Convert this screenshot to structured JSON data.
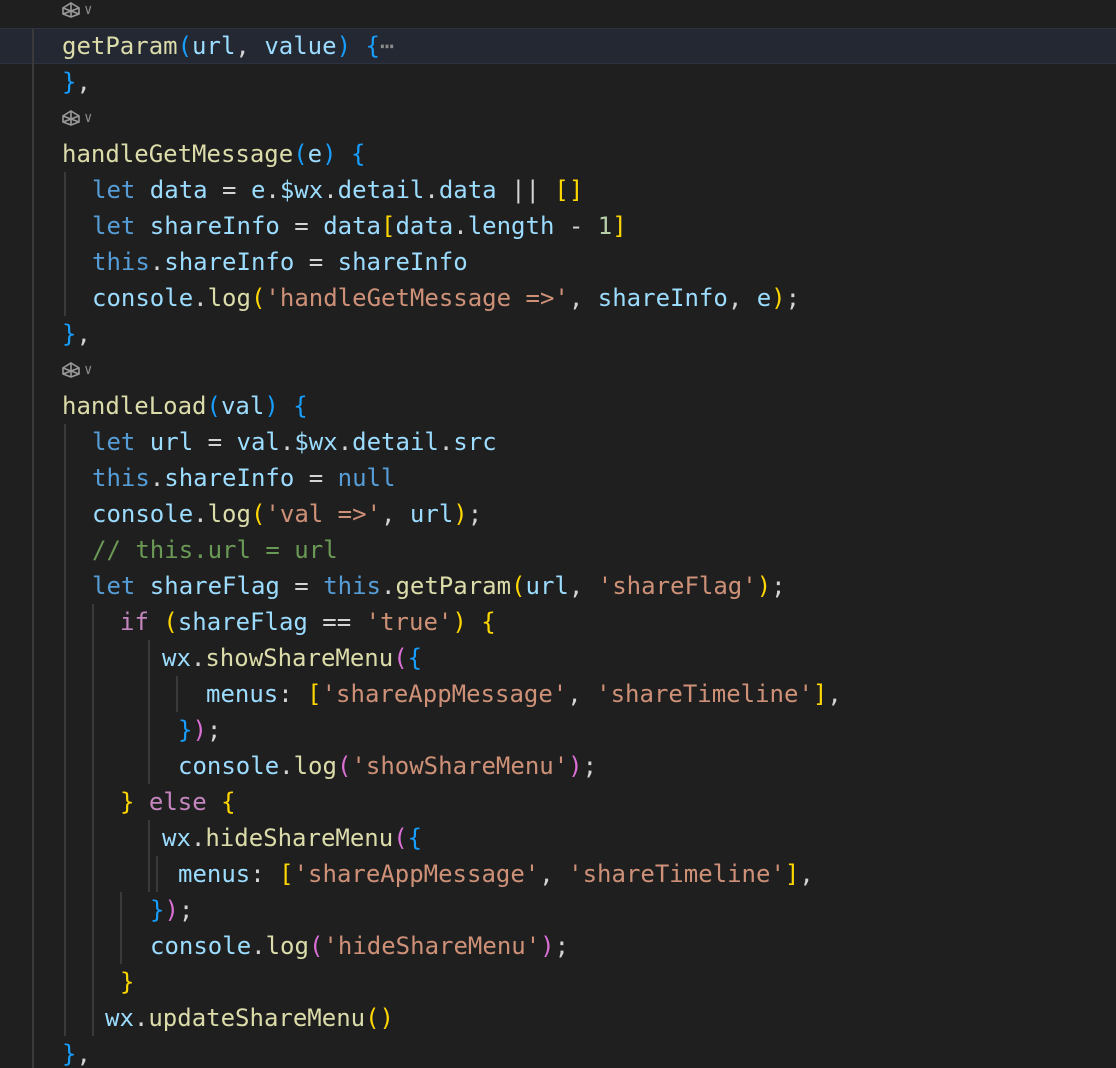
{
  "editor": {
    "lines": [
      {
        "id": "top-partial",
        "tokens": [],
        "guides": [],
        "lens": true
      },
      {
        "id": "getparam",
        "current": true,
        "tokens": [
          {
            "t": "getParam",
            "c": "fn"
          },
          {
            "t": "(",
            "c": "b3"
          },
          {
            "t": "url",
            "c": "var"
          },
          {
            "t": ", ",
            "c": "op"
          },
          {
            "t": "value",
            "c": "var"
          },
          {
            "t": ") ",
            "c": "b3"
          },
          {
            "t": "{",
            "c": "b3"
          },
          {
            "t": "⋯",
            "c": "fold"
          }
        ]
      },
      {
        "id": "close-getparam",
        "tokens": [
          {
            "t": "}",
            "c": "b3"
          },
          {
            "t": ",",
            "c": "op"
          }
        ]
      },
      {
        "id": "lens-1",
        "lens": true
      },
      {
        "id": "handleGetMessage",
        "tokens": [
          {
            "t": "handleGetMessage",
            "c": "fn"
          },
          {
            "t": "(",
            "c": "b3"
          },
          {
            "t": "e",
            "c": "var"
          },
          {
            "t": ") ",
            "c": "b3"
          },
          {
            "t": "{",
            "c": "b3"
          }
        ]
      },
      {
        "id": "hgm-1",
        "indent": 1,
        "tokens": [
          {
            "t": "let ",
            "c": "kw"
          },
          {
            "t": "data",
            "c": "var"
          },
          {
            "t": " = ",
            "c": "op"
          },
          {
            "t": "e",
            "c": "var"
          },
          {
            "t": ".",
            "c": "op"
          },
          {
            "t": "$wx",
            "c": "var"
          },
          {
            "t": ".",
            "c": "op"
          },
          {
            "t": "detail",
            "c": "var"
          },
          {
            "t": ".",
            "c": "op"
          },
          {
            "t": "data",
            "c": "var"
          },
          {
            "t": " || ",
            "c": "op"
          },
          {
            "t": "[]",
            "c": "b1"
          }
        ]
      },
      {
        "id": "hgm-2",
        "indent": 1,
        "tokens": [
          {
            "t": "let ",
            "c": "kw"
          },
          {
            "t": "shareInfo",
            "c": "var"
          },
          {
            "t": " = ",
            "c": "op"
          },
          {
            "t": "data",
            "c": "var"
          },
          {
            "t": "[",
            "c": "b1"
          },
          {
            "t": "data",
            "c": "var"
          },
          {
            "t": ".",
            "c": "op"
          },
          {
            "t": "length",
            "c": "var"
          },
          {
            "t": " - ",
            "c": "op"
          },
          {
            "t": "1",
            "c": "num"
          },
          {
            "t": "]",
            "c": "b1"
          }
        ]
      },
      {
        "id": "hgm-3",
        "indent": 1,
        "tokens": [
          {
            "t": "this",
            "c": "kw"
          },
          {
            "t": ".",
            "c": "op"
          },
          {
            "t": "shareInfo",
            "c": "var"
          },
          {
            "t": " = ",
            "c": "op"
          },
          {
            "t": "shareInfo",
            "c": "var"
          }
        ]
      },
      {
        "id": "hgm-4",
        "indent": 1,
        "tokens": [
          {
            "t": "console",
            "c": "var"
          },
          {
            "t": ".",
            "c": "op"
          },
          {
            "t": "log",
            "c": "fn"
          },
          {
            "t": "(",
            "c": "b1"
          },
          {
            "t": "'handleGetMessage =>'",
            "c": "str"
          },
          {
            "t": ", ",
            "c": "op"
          },
          {
            "t": "shareInfo",
            "c": "var"
          },
          {
            "t": ", ",
            "c": "op"
          },
          {
            "t": "e",
            "c": "var"
          },
          {
            "t": ")",
            "c": "b1"
          },
          {
            "t": ";",
            "c": "op"
          }
        ]
      },
      {
        "id": "close-hgm",
        "tokens": [
          {
            "t": "}",
            "c": "b3"
          },
          {
            "t": ",",
            "c": "op"
          }
        ]
      },
      {
        "id": "lens-2",
        "lens": true
      },
      {
        "id": "handleLoad",
        "tokens": [
          {
            "t": "handleLoad",
            "c": "fn"
          },
          {
            "t": "(",
            "c": "b3"
          },
          {
            "t": "val",
            "c": "var"
          },
          {
            "t": ") ",
            "c": "b3"
          },
          {
            "t": "{",
            "c": "b3"
          }
        ]
      },
      {
        "id": "hl-1",
        "indent": 1,
        "tokens": [
          {
            "t": "let ",
            "c": "kw"
          },
          {
            "t": "url",
            "c": "var"
          },
          {
            "t": " = ",
            "c": "op"
          },
          {
            "t": "val",
            "c": "var"
          },
          {
            "t": ".",
            "c": "op"
          },
          {
            "t": "$wx",
            "c": "var"
          },
          {
            "t": ".",
            "c": "op"
          },
          {
            "t": "detail",
            "c": "var"
          },
          {
            "t": ".",
            "c": "op"
          },
          {
            "t": "src",
            "c": "var"
          }
        ]
      },
      {
        "id": "hl-2",
        "indent": 1,
        "tokens": [
          {
            "t": "this",
            "c": "kw"
          },
          {
            "t": ".",
            "c": "op"
          },
          {
            "t": "shareInfo",
            "c": "var"
          },
          {
            "t": " = ",
            "c": "op"
          },
          {
            "t": "null",
            "c": "kw"
          }
        ]
      },
      {
        "id": "hl-3",
        "indent": 1,
        "tokens": [
          {
            "t": "console",
            "c": "var"
          },
          {
            "t": ".",
            "c": "op"
          },
          {
            "t": "log",
            "c": "fn"
          },
          {
            "t": "(",
            "c": "b1"
          },
          {
            "t": "'val =>'",
            "c": "str"
          },
          {
            "t": ", ",
            "c": "op"
          },
          {
            "t": "url",
            "c": "var"
          },
          {
            "t": ")",
            "c": "b1"
          },
          {
            "t": ";",
            "c": "op"
          }
        ]
      },
      {
        "id": "hl-4",
        "indent": 1,
        "tokens": [
          {
            "t": "// this.url = url",
            "c": "cmt"
          }
        ]
      },
      {
        "id": "hl-5",
        "indent": 1,
        "tokens": [
          {
            "t": "let ",
            "c": "kw"
          },
          {
            "t": "shareFlag",
            "c": "var"
          },
          {
            "t": " = ",
            "c": "op"
          },
          {
            "t": "this",
            "c": "kw"
          },
          {
            "t": ".",
            "c": "op"
          },
          {
            "t": "getParam",
            "c": "fn"
          },
          {
            "t": "(",
            "c": "b1"
          },
          {
            "t": "url",
            "c": "var"
          },
          {
            "t": ", ",
            "c": "op"
          },
          {
            "t": "'shareFlag'",
            "c": "str"
          },
          {
            "t": ")",
            "c": "b1"
          },
          {
            "t": ";",
            "c": "op"
          }
        ]
      },
      {
        "id": "if",
        "indent": 2,
        "tokens": [
          {
            "t": "if ",
            "c": "ctl"
          },
          {
            "t": "(",
            "c": "b1"
          },
          {
            "t": "shareFlag",
            "c": "var"
          },
          {
            "t": " == ",
            "c": "op"
          },
          {
            "t": "'true'",
            "c": "str"
          },
          {
            "t": ") ",
            "c": "b1"
          },
          {
            "t": "{",
            "c": "b1"
          }
        ]
      },
      {
        "id": "show-1",
        "indent": 3,
        "tokens": [
          {
            "t": "wx",
            "c": "var"
          },
          {
            "t": ".",
            "c": "op"
          },
          {
            "t": "showShareMenu",
            "c": "fn"
          },
          {
            "t": "(",
            "c": "b2"
          },
          {
            "t": "{",
            "c": "b3"
          }
        ]
      },
      {
        "id": "show-2",
        "indent": 4,
        "tokens": [
          {
            "t": "menus",
            "c": "var"
          },
          {
            "t": ": ",
            "c": "op"
          },
          {
            "t": "[",
            "c": "b1"
          },
          {
            "t": "'shareAppMessage'",
            "c": "str"
          },
          {
            "t": ", ",
            "c": "op"
          },
          {
            "t": "'shareTimeline'",
            "c": "str"
          },
          {
            "t": "]",
            "c": "b1"
          },
          {
            "t": ",",
            "c": "op"
          }
        ]
      },
      {
        "id": "show-3",
        "indent": 5,
        "tokens": [
          {
            "t": "}",
            "c": "b3"
          },
          {
            "t": ")",
            "c": "b2"
          },
          {
            "t": ";",
            "c": "op"
          }
        ]
      },
      {
        "id": "show-4",
        "indent": 5,
        "tokens": [
          {
            "t": "console",
            "c": "var"
          },
          {
            "t": ".",
            "c": "op"
          },
          {
            "t": "log",
            "c": "fn"
          },
          {
            "t": "(",
            "c": "b2"
          },
          {
            "t": "'showShareMenu'",
            "c": "str"
          },
          {
            "t": ")",
            "c": "b2"
          },
          {
            "t": ";",
            "c": "op"
          }
        ]
      },
      {
        "id": "else",
        "indent": 2,
        "tokens": [
          {
            "t": "} ",
            "c": "b1"
          },
          {
            "t": "else ",
            "c": "ctl"
          },
          {
            "t": "{",
            "c": "b1"
          }
        ]
      },
      {
        "id": "hide-1",
        "indent": 3,
        "tokens": [
          {
            "t": "wx",
            "c": "var"
          },
          {
            "t": ".",
            "c": "op"
          },
          {
            "t": "hideShareMenu",
            "c": "fn"
          },
          {
            "t": "(",
            "c": "b2"
          },
          {
            "t": "{",
            "c": "b3"
          }
        ]
      },
      {
        "id": "hide-2",
        "indent": 6,
        "tokens": [
          {
            "t": "menus",
            "c": "var"
          },
          {
            "t": ": ",
            "c": "op"
          },
          {
            "t": "[",
            "c": "b1"
          },
          {
            "t": "'shareAppMessage'",
            "c": "str"
          },
          {
            "t": ", ",
            "c": "op"
          },
          {
            "t": "'shareTimeline'",
            "c": "str"
          },
          {
            "t": "]",
            "c": "b1"
          },
          {
            "t": ",",
            "c": "op"
          }
        ]
      },
      {
        "id": "hide-3",
        "indent": 7,
        "tokens": [
          {
            "t": "}",
            "c": "b3"
          },
          {
            "t": ")",
            "c": "b2"
          },
          {
            "t": ";",
            "c": "op"
          }
        ]
      },
      {
        "id": "hide-4",
        "indent": 7,
        "tokens": [
          {
            "t": "console",
            "c": "var"
          },
          {
            "t": ".",
            "c": "op"
          },
          {
            "t": "log",
            "c": "fn"
          },
          {
            "t": "(",
            "c": "b2"
          },
          {
            "t": "'hideShareMenu'",
            "c": "str"
          },
          {
            "t": ")",
            "c": "b2"
          },
          {
            "t": ";",
            "c": "op"
          }
        ]
      },
      {
        "id": "close-if",
        "indent": 2,
        "tokens": [
          {
            "t": "}",
            "c": "b1"
          }
        ]
      },
      {
        "id": "update",
        "indent": 8,
        "tokens": [
          {
            "t": "wx",
            "c": "var"
          },
          {
            "t": ".",
            "c": "op"
          },
          {
            "t": "updateShareMenu",
            "c": "fn"
          },
          {
            "t": "()",
            "c": "b1"
          }
        ]
      },
      {
        "id": "close-hl",
        "tokens": [
          {
            "t": "}",
            "c": "b3"
          },
          {
            "t": ",",
            "c": "op"
          }
        ]
      },
      {
        "id": "lens-3",
        "lens": true
      }
    ]
  },
  "colors": {
    "background": "#1f1f1f",
    "current_line": "#232833",
    "guide": "#3a3a3a"
  }
}
